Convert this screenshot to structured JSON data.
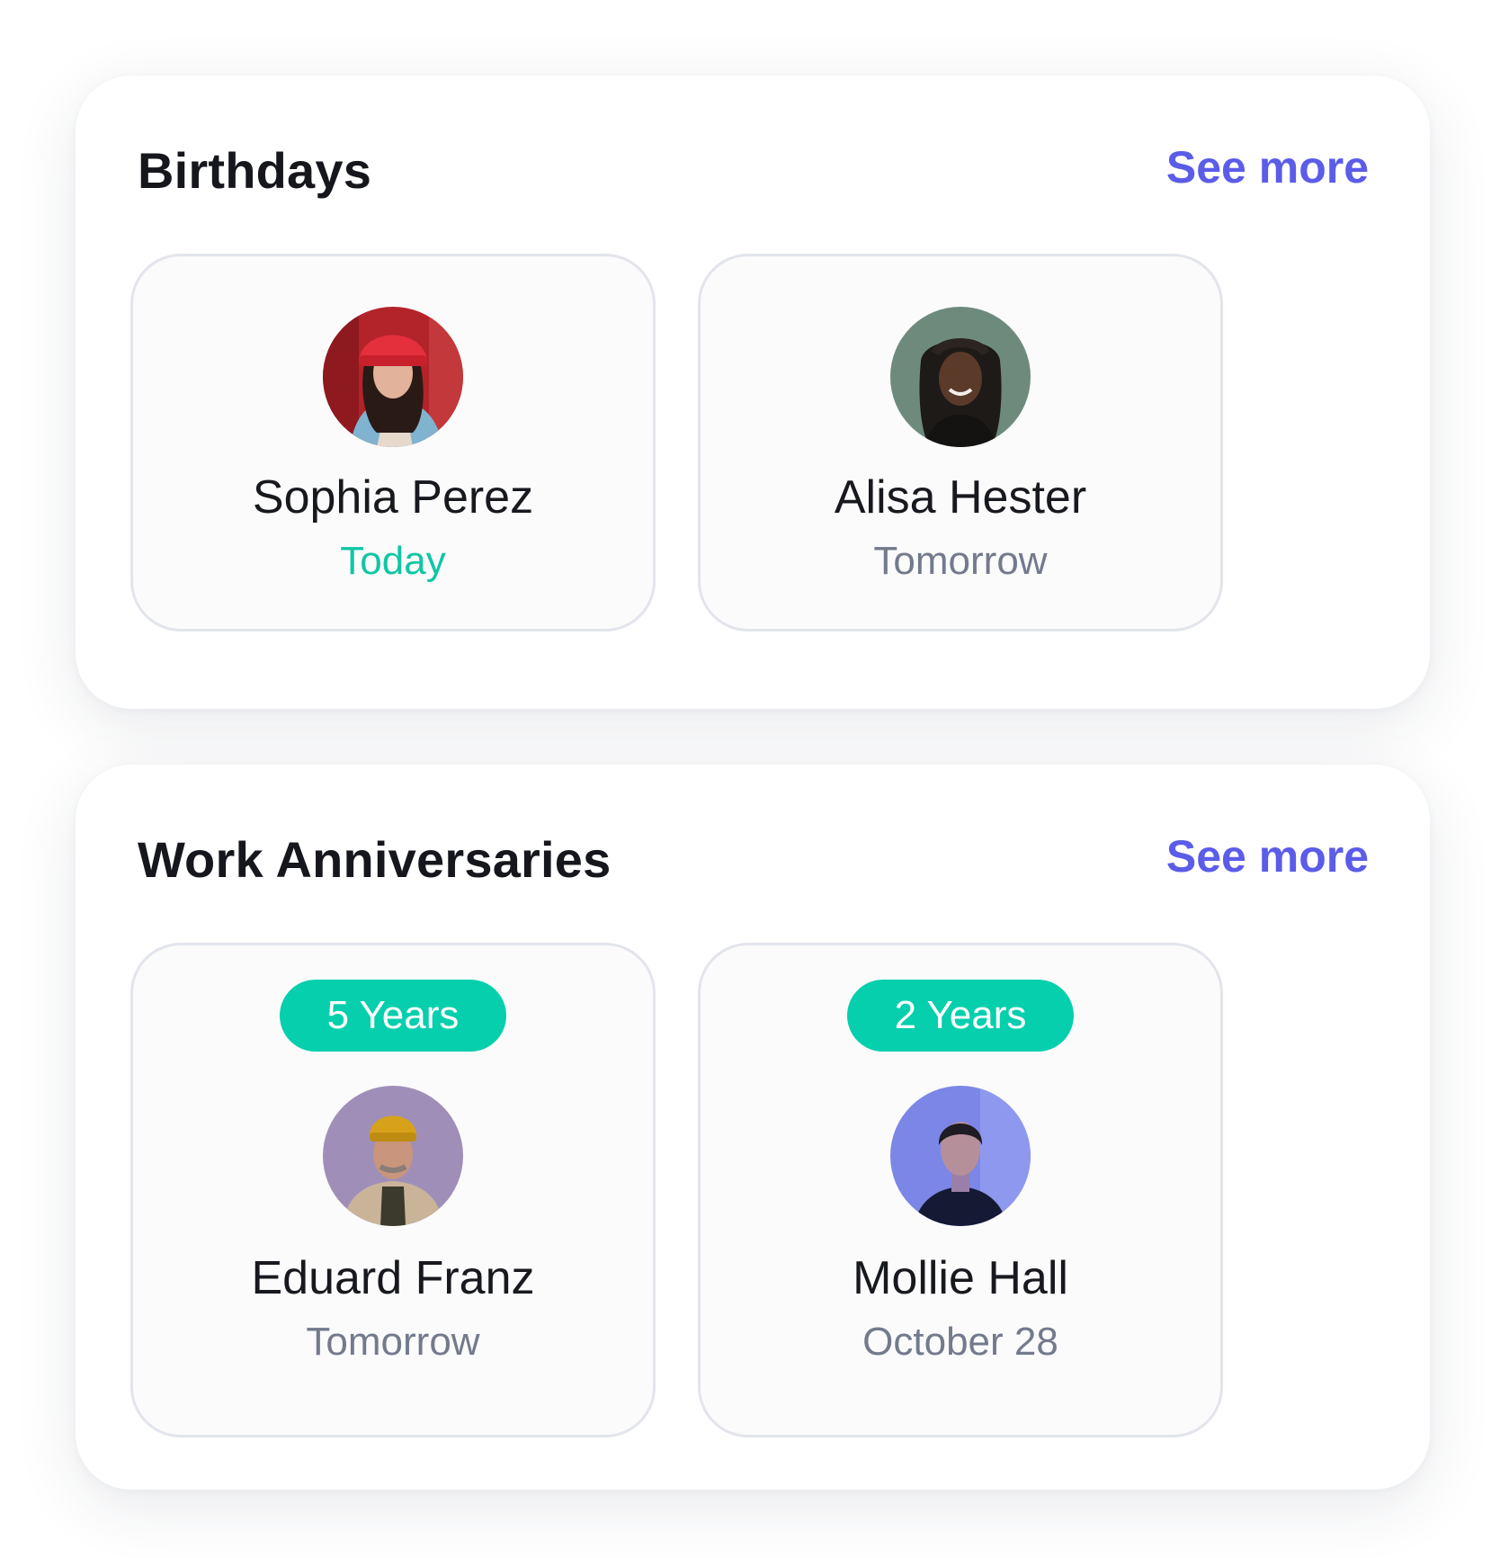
{
  "colors": {
    "accent": "#5b5ce8",
    "badge": "#06cfad",
    "today": "#10c6a5",
    "muted": "#737a8c"
  },
  "birthdays": {
    "title": "Birthdays",
    "see_more": "See more",
    "people": [
      {
        "name": "Sophia Perez",
        "when": "Today",
        "avatar_icon": "avatar-photo-red-beanie"
      },
      {
        "name": "Alisa Hester",
        "when": "Tomorrow",
        "avatar_icon": "avatar-photo-braids"
      }
    ]
  },
  "anniversaries": {
    "title": "Work Anniversaries",
    "see_more": "See more",
    "people": [
      {
        "badge": "5 Years",
        "name": "Eduard Franz",
        "when": "Tomorrow",
        "avatar_icon": "avatar-photo-yellow-beanie"
      },
      {
        "badge": "2 Years",
        "name": "Mollie Hall",
        "when": "October 28",
        "avatar_icon": "avatar-photo-blue-light"
      }
    ]
  }
}
